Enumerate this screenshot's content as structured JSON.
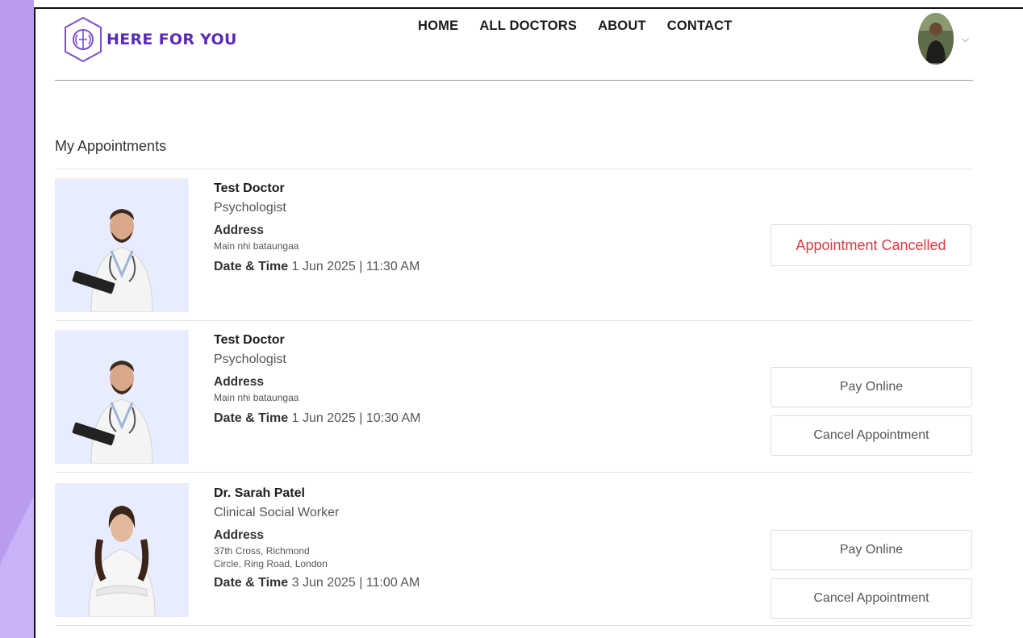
{
  "brand": {
    "name": "HERE FOR YOU",
    "accent": "#5b2bb8"
  },
  "nav": [
    {
      "label": "HOME"
    },
    {
      "label": "ALL DOCTORS"
    },
    {
      "label": "ABOUT"
    },
    {
      "label": "CONTACT"
    }
  ],
  "profile": {
    "icon": "chevron-down-icon",
    "chevron": "⌵"
  },
  "page_title": "My Appointments",
  "appointments": [
    {
      "name": "Test Doctor",
      "speciality": "Psychologist",
      "address_label": "Address",
      "address_line1": "Main nhi bataungaa",
      "address_line2": "",
      "datetime_label": "Date & Time",
      "datetime": "1 Jun 2025 | 11:30 AM",
      "status": "Appointment Cancelled"
    },
    {
      "name": "Test Doctor",
      "speciality": "Psychologist",
      "address_label": "Address",
      "address_line1": "Main nhi bataungaa",
      "address_line2": "",
      "datetime_label": "Date & Time",
      "datetime": "1 Jun 2025 | 10:30 AM",
      "pay_label": "Pay Online",
      "cancel_label": "Cancel Appointment"
    },
    {
      "name": "Dr. Sarah Patel",
      "speciality": "Clinical Social Worker",
      "address_label": "Address",
      "address_line1": "37th Cross, Richmond",
      "address_line2": "Circle, Ring Road, London",
      "datetime_label": "Date & Time",
      "datetime": "3 Jun 2025 | 11:00 AM",
      "pay_label": "Pay Online",
      "cancel_label": "Cancel Appointment"
    }
  ],
  "colors": {
    "cancelled": "#e0383f",
    "photo_bg": "#e8ecff",
    "side": "#b99bf0"
  }
}
